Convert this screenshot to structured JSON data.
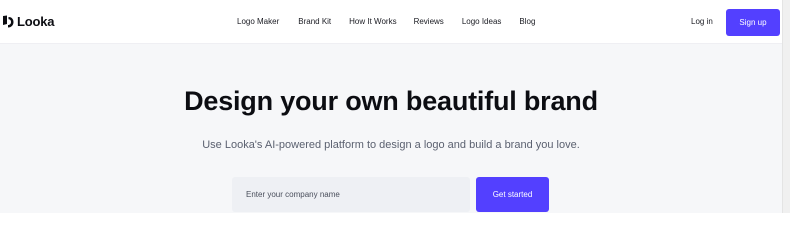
{
  "brand": {
    "name": "Looka",
    "accent_color": "#5340ff"
  },
  "nav": {
    "links": [
      {
        "label": "Logo Maker"
      },
      {
        "label": "Brand Kit"
      },
      {
        "label": "How It Works"
      },
      {
        "label": "Reviews"
      },
      {
        "label": "Logo Ideas"
      },
      {
        "label": "Blog"
      }
    ],
    "login_label": "Log in",
    "signup_label": "Sign up"
  },
  "hero": {
    "title": "Design your own beautiful brand",
    "subtitle": "Use Looka's AI-powered platform to design a logo and build a brand you love.",
    "input_placeholder": "Enter your company name",
    "input_value": "",
    "cta_label": "Get started"
  }
}
